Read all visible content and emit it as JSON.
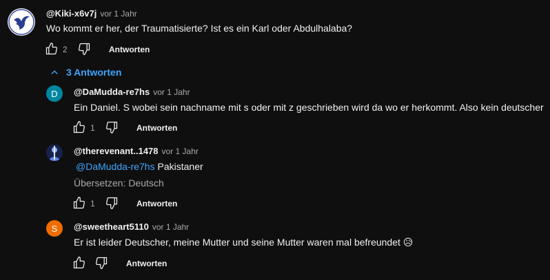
{
  "comment": {
    "handle": "@Kiki-x6v7j",
    "time": "vor 1 Jahr",
    "text": "Wo kommt er her, der Traumatisierte? Ist es ein Karl oder Abdulhalaba?",
    "likes": "2",
    "reply_label": "Antworten"
  },
  "replies_toggle": "3 Antworten",
  "replies": [
    {
      "avatar_letter": "D",
      "avatar_color": "#00879f",
      "handle": "@DaMudda-re7hs",
      "time": "vor 1 Jahr",
      "text": "Ein Daniel. S wobei sein nachname mit s oder mit z geschrieben wird da wo er herkommt. Also kein deutscher",
      "likes": "1",
      "reply_label": "Antworten"
    },
    {
      "handle": "@therevenant..1478",
      "time": "vor 1 Jahr",
      "mention": "@DaMudda-re7hs",
      "text": " Pakistaner",
      "translate": "Übersetzen: Deutsch",
      "likes": "1",
      "reply_label": "Antworten"
    },
    {
      "avatar_letter": "S",
      "avatar_color": "#ef6c00",
      "handle": "@sweetheart5110",
      "time": "vor 1 Jahr",
      "text": "Er ist leider Deutscher, meine Mutter und seine Mutter waren mal befreundet 😥",
      "reply_label": "Antworten"
    }
  ]
}
